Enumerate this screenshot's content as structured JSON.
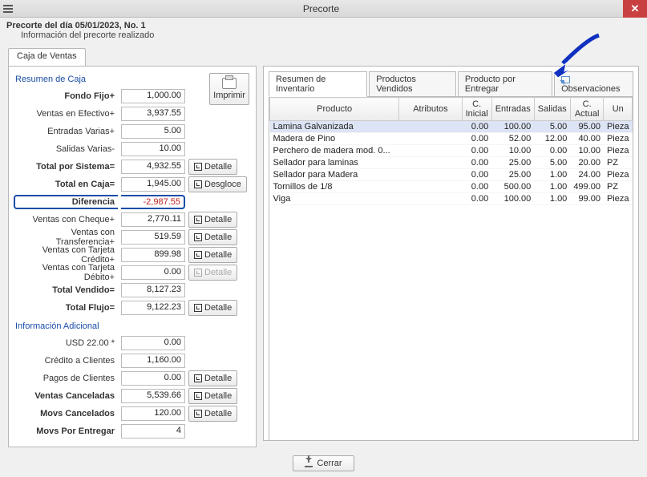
{
  "window": {
    "title": "Precorte",
    "subtitle1": "Precorte del día 05/01/2023, No. 1",
    "subtitle2": "Información del precorte realizado"
  },
  "left": {
    "tab": "Caja de Ventas",
    "section1": "Resumen de Caja",
    "section2": "Información Adicional",
    "print": "Imprimir",
    "detalle": "Detalle",
    "desgloce": "Desgloce",
    "rows": {
      "fondo_fijo": {
        "label": "Fondo Fijo+",
        "value": "1,000.00"
      },
      "ventas_efectivo": {
        "label": "Ventas en Efectivo+",
        "value": "3,937.55"
      },
      "entradas_varias": {
        "label": "Entradas Varias+",
        "value": "5.00"
      },
      "salidas_varias": {
        "label": "Salidas Varias-",
        "value": "10.00"
      },
      "total_sistema": {
        "label": "Total por Sistema=",
        "value": "4,932.55"
      },
      "total_caja": {
        "label": "Total en Caja=",
        "value": "1,945.00"
      },
      "diferencia": {
        "label": "Diferencia",
        "value": "-2,987.55"
      },
      "ventas_cheque": {
        "label": "Ventas con Cheque+",
        "value": "2,770.11"
      },
      "ventas_transfer": {
        "label": "Ventas con Transferencia+",
        "value": "519.59"
      },
      "ventas_tc": {
        "label": "Ventas con Tarjeta Crédito+",
        "value": "899.98"
      },
      "ventas_td": {
        "label": "Ventas con Tarjeta Débito+",
        "value": "0.00"
      },
      "total_vendido": {
        "label": "Total Vendido=",
        "value": "8,127.23"
      },
      "total_flujo": {
        "label": "Total Flujo=",
        "value": "9,122.23"
      },
      "usd": {
        "label": "USD 22.00 *",
        "value": "0.00"
      },
      "credito": {
        "label": "Crédito a Clientes",
        "value": "1,160.00"
      },
      "pagos": {
        "label": "Pagos de Clientes",
        "value": "0.00"
      },
      "ventas_canc": {
        "label": "Ventas Canceladas",
        "value": "5,539.66"
      },
      "movs_canc": {
        "label": "Movs Cancelados",
        "value": "120.00"
      },
      "movs_entregar": {
        "label": "Movs Por Entregar",
        "value": "4"
      }
    }
  },
  "right": {
    "tabs": {
      "t1": "Resumen de Inventario",
      "t2": "Productos Vendidos",
      "t3": "Producto por Entregar",
      "t4": "Observaciones"
    },
    "headers": {
      "producto": "Producto",
      "atributos": "Atributos",
      "cinicial": "C. Inicial",
      "entradas": "Entradas",
      "salidas": "Salidas",
      "cactual": "C. Actual",
      "un": "Un"
    },
    "data": [
      {
        "producto": "Lamina Galvanizada",
        "atr": "",
        "ci": "0.00",
        "ent": "100.00",
        "sal": "5.00",
        "ca": "95.00",
        "un": "Pieza"
      },
      {
        "producto": "Madera de Pino",
        "atr": "",
        "ci": "0.00",
        "ent": "52.00",
        "sal": "12.00",
        "ca": "40.00",
        "un": "Pieza"
      },
      {
        "producto": "Perchero de madera mod. 0...",
        "atr": "",
        "ci": "0.00",
        "ent": "10.00",
        "sal": "0.00",
        "ca": "10.00",
        "un": "Pieza"
      },
      {
        "producto": "Sellador para laminas",
        "atr": "",
        "ci": "0.00",
        "ent": "25.00",
        "sal": "5.00",
        "ca": "20.00",
        "un": "PZ"
      },
      {
        "producto": "Sellador para Madera",
        "atr": "",
        "ci": "0.00",
        "ent": "25.00",
        "sal": "1.00",
        "ca": "24.00",
        "un": "Pieza"
      },
      {
        "producto": "Tornillos de 1/8",
        "atr": "",
        "ci": "0.00",
        "ent": "500.00",
        "sal": "1.00",
        "ca": "499.00",
        "un": "PZ"
      },
      {
        "producto": "Viga",
        "atr": "",
        "ci": "0.00",
        "ent": "100.00",
        "sal": "1.00",
        "ca": "99.00",
        "un": "Pieza"
      }
    ]
  },
  "footer": {
    "cerrar": "Cerrar"
  }
}
